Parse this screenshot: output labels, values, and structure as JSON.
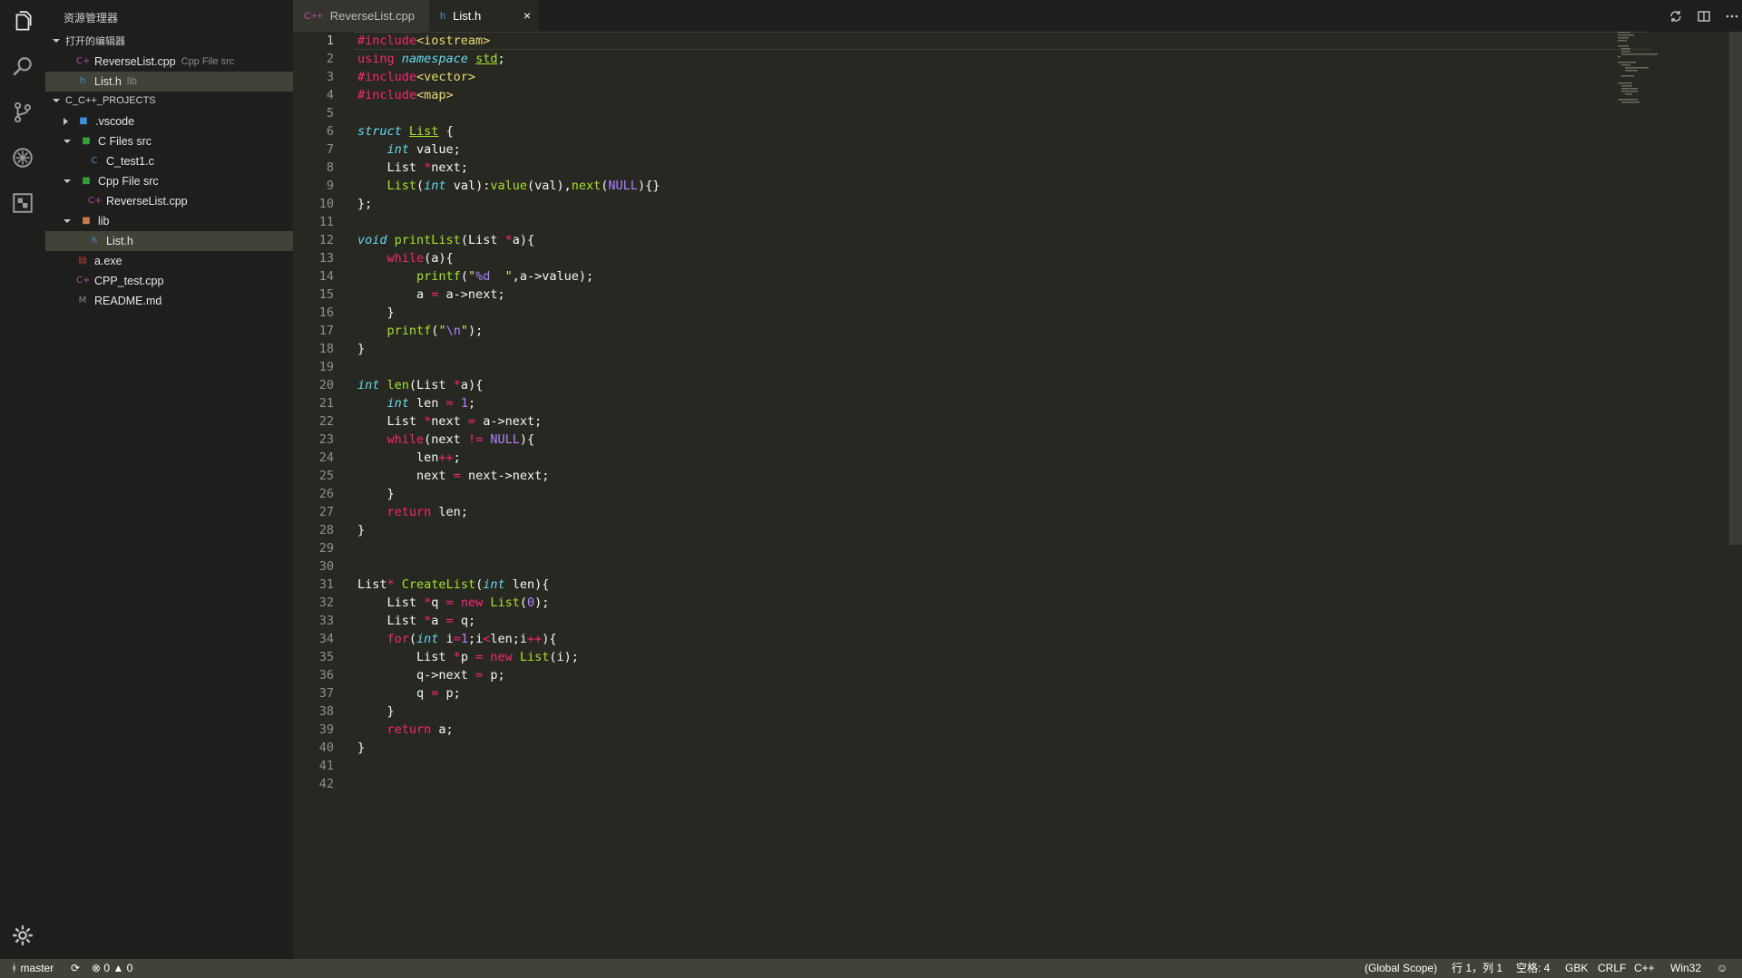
{
  "sidebar": {
    "title": "资源管理器",
    "open_editors_label": "打开的编辑器",
    "open_editors": [
      {
        "name": "ReverseList.cpp",
        "desc": "Cpp File src"
      },
      {
        "name": "List.h",
        "desc": "lib"
      }
    ],
    "project_label": "C_C++_PROJECTS",
    "tree": [
      {
        "name": ".vscode"
      },
      {
        "name": "C Files src"
      },
      {
        "name": "C_test1.c"
      },
      {
        "name": "Cpp File src"
      },
      {
        "name": "ReverseList.cpp"
      },
      {
        "name": "lib"
      },
      {
        "name": "List.h"
      },
      {
        "name": "a.exe"
      },
      {
        "name": "CPP_test.cpp"
      },
      {
        "name": "README.md"
      }
    ]
  },
  "tabs": [
    {
      "label": "ReverseList.cpp",
      "icon": "C++"
    },
    {
      "label": "List.h",
      "icon": "h",
      "close": "×"
    }
  ],
  "editor": {
    "line_numbers": [
      "1",
      "2",
      "3",
      "4",
      "5",
      "6",
      "7",
      "8",
      "9",
      "10",
      "11",
      "12",
      "13",
      "14",
      "15",
      "16",
      "17",
      "18",
      "19",
      "20",
      "21",
      "22",
      "23",
      "24",
      "25",
      "26",
      "27",
      "28",
      "29",
      "30",
      "31",
      "32",
      "33",
      "34",
      "35",
      "36",
      "37",
      "38",
      "39",
      "40",
      "41",
      "42"
    ],
    "current_line": 1
  },
  "status": {
    "branch": "master",
    "errors": "0",
    "warnings": "0",
    "scope": "(Global Scope)",
    "position": "行 1，列 1",
    "indent": "空格: 4",
    "encoding": "GBK",
    "eol": "CRLF",
    "language": "C++",
    "platform": "Win32"
  },
  "colors": {
    "editor_bg": "#272822",
    "sidebar_bg": "#1e1f1c",
    "status_bg": "#414339",
    "keyword": "#f92672",
    "type": "#66d9ef",
    "function": "#a6e22e",
    "string": "#e6db74",
    "number": "#ae81ff"
  },
  "icons": [
    "files-icon",
    "search-icon",
    "source-control-icon",
    "debug-icon",
    "extensions-icon",
    "settings-gear-icon",
    "open-changes-icon",
    "split-editor-icon",
    "more-actions-icon",
    "git-branch-icon",
    "sync-icon",
    "error-icon",
    "warning-icon",
    "feedback-smiley-icon"
  ]
}
